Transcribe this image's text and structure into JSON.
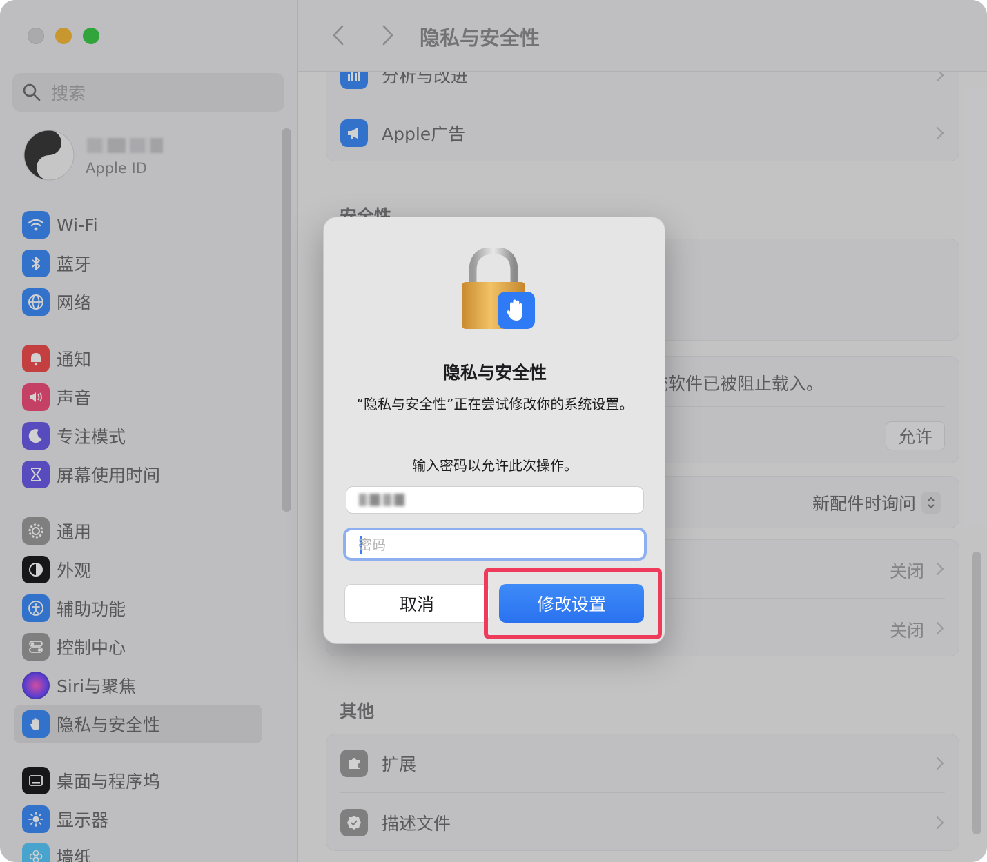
{
  "sidebar": {
    "search_placeholder": "搜索",
    "apple_id_label": "Apple ID",
    "items": [
      {
        "label": "Wi-Fi",
        "color": "#3d8bf7"
      },
      {
        "label": "蓝牙",
        "color": "#3d8bf7"
      },
      {
        "label": "网络",
        "color": "#3d8bf7"
      },
      {
        "label": "通知",
        "color": "#ef4f4f"
      },
      {
        "label": "声音",
        "color": "#ef4f7a"
      },
      {
        "label": "专注模式",
        "color": "#6b5ce7"
      },
      {
        "label": "屏幕使用时间",
        "color": "#6b5ce7"
      },
      {
        "label": "通用",
        "color": "#9b9b9d"
      },
      {
        "label": "外观",
        "color": "#1d1d1f"
      },
      {
        "label": "辅助功能",
        "color": "#3d8bf7"
      },
      {
        "label": "控制中心",
        "color": "#9b9b9d"
      },
      {
        "label": "Siri与聚焦",
        "color": "#b25adf"
      },
      {
        "label": "隐私与安全性",
        "color": "#3d8bf7"
      },
      {
        "label": "桌面与程序坞",
        "color": "#1d1d1f"
      },
      {
        "label": "显示器",
        "color": "#3d8bf7"
      },
      {
        "label": "墙纸",
        "color": "#5ac8fa"
      }
    ]
  },
  "toolbar": {
    "title": "隐私与安全性"
  },
  "main": {
    "row_analytics": "分析与改进",
    "row_apple_ads": "Apple广告",
    "section_security": "安全性",
    "blocked_text": "统软件已被阻止载入。",
    "allow_button": "允许",
    "accessory_value": "新配件时询问",
    "off_value_1": "关闭",
    "off_value_2": "关闭",
    "section_other": "其他",
    "row_extensions": "扩展",
    "row_profiles": "描述文件"
  },
  "dialog": {
    "title": "隐私与安全性",
    "message": "“隐私与安全性”正在尝试修改你的系统设置。",
    "prompt": "输入密码以允许此次操作。",
    "password_placeholder": "密码",
    "cancel_label": "取消",
    "confirm_label": "修改设置",
    "accent_color": "#2f7bf5",
    "highlight_color": "#ee3a5b"
  }
}
